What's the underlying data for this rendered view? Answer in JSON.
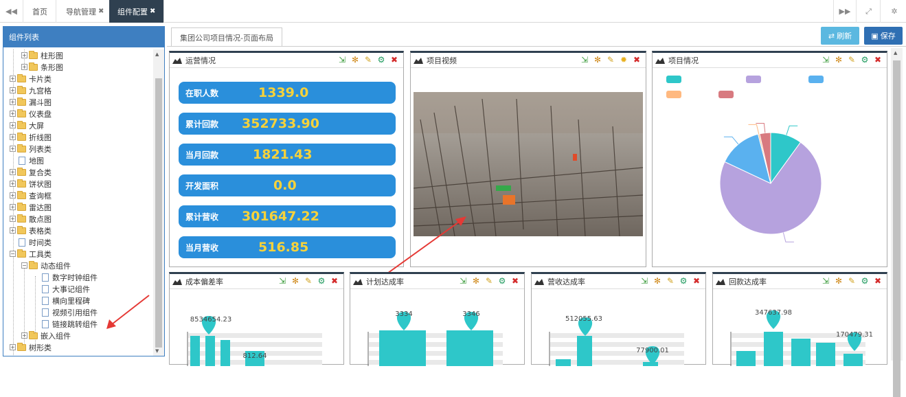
{
  "tabs": [
    {
      "label": "首页"
    },
    {
      "label": "导航管理"
    },
    {
      "label": "组件配置"
    }
  ],
  "left_panel": {
    "title": "组件列表",
    "tree": [
      {
        "label": "柱形图"
      },
      {
        "label": "条形图"
      },
      {
        "label": "卡片类"
      },
      {
        "label": "九宫格"
      },
      {
        "label": "漏斗图"
      },
      {
        "label": "仪表盘"
      },
      {
        "label": "大屏"
      },
      {
        "label": "折线图"
      },
      {
        "label": "列表类"
      },
      {
        "label": "地图"
      },
      {
        "label": "复合类"
      },
      {
        "label": "饼状图"
      },
      {
        "label": "查询框"
      },
      {
        "label": "雷达图"
      },
      {
        "label": "散点图"
      },
      {
        "label": "表格类"
      },
      {
        "label": "时间类"
      },
      {
        "label": "工具类"
      },
      {
        "label": "动态组件"
      },
      {
        "label": "数字时钟组件"
      },
      {
        "label": "大事记组件"
      },
      {
        "label": "横向里程碑"
      },
      {
        "label": "视频引用组件"
      },
      {
        "label": "链接跳转组件"
      },
      {
        "label": "嵌入组件"
      },
      {
        "label": "树形类"
      }
    ]
  },
  "main": {
    "page_tab": "集团公司项目情况-页面布局",
    "refresh_label": "刷新",
    "save_label": "保存",
    "widgets": {
      "operations": {
        "title": "运营情况",
        "stats": [
          {
            "label": "在职人数",
            "value": "1339.0"
          },
          {
            "label": "累计回款",
            "value": "352733.90"
          },
          {
            "label": "当月回款",
            "value": "1821.43"
          },
          {
            "label": "开发面积",
            "value": "0.0"
          },
          {
            "label": "累计营收",
            "value": "301647.22"
          },
          {
            "label": "当月营收",
            "value": "516.85"
          }
        ]
      },
      "video": {
        "title": "项目视频"
      },
      "project": {
        "title": "项目情况"
      },
      "cost": {
        "title": "成本偏差率"
      },
      "plan": {
        "title": "计划达成率"
      },
      "revenue": {
        "title": "营收达成率"
      },
      "payback": {
        "title": "回款达成率"
      }
    }
  },
  "chart_data": [
    {
      "type": "pie",
      "legend_colors": [
        "#2ec7c9",
        "#b6a2de",
        "#5ab1ef",
        "#ffb980",
        "#d87a80"
      ],
      "slices": [
        {
          "value": 10,
          "color": "#2ec7c9"
        },
        {
          "value": 72,
          "color": "#b6a2de"
        },
        {
          "value": 14,
          "color": "#5ab1ef"
        },
        {
          "value": 0.5,
          "color": "#ffb980"
        },
        {
          "value": 3.5,
          "color": "#d87a80"
        }
      ]
    },
    {
      "type": "bar",
      "data_labels": [
        "8534654.23",
        "812.64"
      ]
    },
    {
      "type": "bar",
      "data_labels": [
        "3334",
        "3346"
      ]
    },
    {
      "type": "bar",
      "data_labels": [
        "512055.63",
        "77900.01"
      ]
    },
    {
      "type": "bar",
      "data_labels": [
        "347637.98",
        "170479.31"
      ]
    }
  ]
}
